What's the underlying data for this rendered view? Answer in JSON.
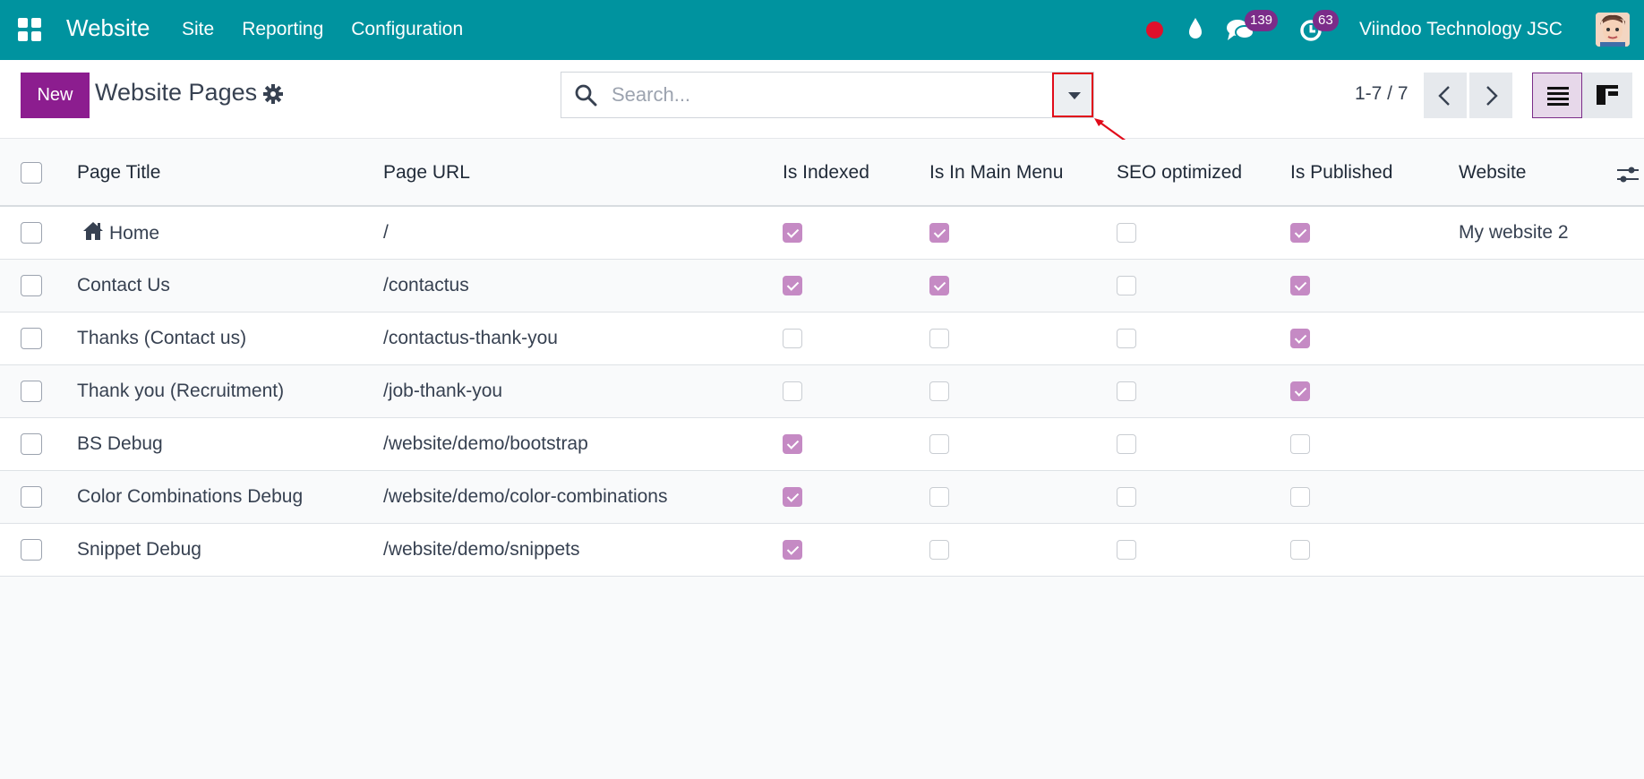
{
  "app": {
    "name": "Website",
    "menu": [
      "Site",
      "Reporting",
      "Configuration"
    ],
    "company": "Viindoo Technology JSC",
    "badges": {
      "messages": "139",
      "activities": "63"
    },
    "colors": {
      "navbar": "#00939f",
      "primary": "#8c1d8f",
      "badge": "#7b2c89",
      "check": "#c58ac4",
      "annotation": "#e10b1a"
    }
  },
  "control": {
    "new_label": "New",
    "title": "Website Pages",
    "search_placeholder": "Search...",
    "pager": "1-7 / 7"
  },
  "table": {
    "columns": [
      "Page Title",
      "Page URL",
      "Is Indexed",
      "Is In Main Menu",
      "SEO optimized",
      "Is Published",
      "Website"
    ],
    "rows": [
      {
        "title": "Home",
        "url": "/",
        "indexed": true,
        "main_menu": true,
        "seo": false,
        "published": true,
        "website": "My website 2",
        "icon": "home-icon"
      },
      {
        "title": "Contact Us",
        "url": "/contactus",
        "indexed": true,
        "main_menu": true,
        "seo": false,
        "published": true,
        "website": ""
      },
      {
        "title": "Thanks (Contact us)",
        "url": "/contactus-thank-you",
        "indexed": false,
        "main_menu": false,
        "seo": false,
        "published": true,
        "website": ""
      },
      {
        "title": "Thank you (Recruitment)",
        "url": "/job-thank-you",
        "indexed": false,
        "main_menu": false,
        "seo": false,
        "published": true,
        "website": ""
      },
      {
        "title": "BS Debug",
        "url": "/website/demo/bootstrap",
        "indexed": true,
        "main_menu": false,
        "seo": false,
        "published": false,
        "website": ""
      },
      {
        "title": "Color Combinations Debug",
        "url": "/website/demo/color-combinations",
        "indexed": true,
        "main_menu": false,
        "seo": false,
        "published": false,
        "website": ""
      },
      {
        "title": "Snippet Debug",
        "url": "/website/demo/snippets",
        "indexed": true,
        "main_menu": false,
        "seo": false,
        "published": false,
        "website": ""
      }
    ]
  }
}
